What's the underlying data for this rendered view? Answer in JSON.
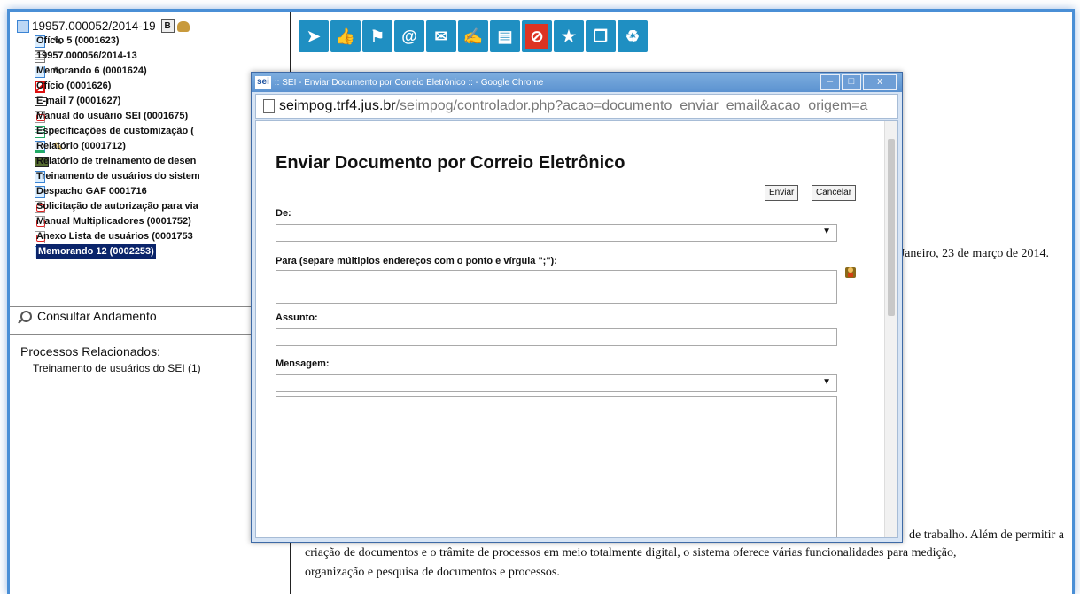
{
  "tree": {
    "process": {
      "label": "19957.000052/2014-19",
      "badge": "B"
    },
    "items": [
      {
        "label": "Ofício 5 (0001623)",
        "icon": "doc-icon",
        "pen": true
      },
      {
        "label": "19957.000056/2014-13",
        "icon": "linked-process-icon"
      },
      {
        "label": "Memorando 6 (0001624)",
        "icon": "doc-icon",
        "pen": true
      },
      {
        "label": "Ofício (0001626)",
        "icon": "cancelled-doc-icon",
        "style": "gray"
      },
      {
        "label": "E-mail 7 (0001627)",
        "icon": "email-icon"
      },
      {
        "label": "Manual do usuário SEI (0001675)",
        "icon": "pdf-icon"
      },
      {
        "label": "Especificações de customização (",
        "icon": "spreadsheet-icon"
      },
      {
        "label": "Relatório (0001712)",
        "icon": "report-icon",
        "pen": "gold"
      },
      {
        "label": "Relatório de treinamento de desen",
        "icon": "video-icon"
      },
      {
        "label": "Treinamento de usuários do sistem",
        "icon": "doc-icon",
        "style": "gray"
      },
      {
        "label": "Despacho GAF 0001716",
        "icon": "doc-icon",
        "style": "gray"
      },
      {
        "label": "Solicitação de autorização para via",
        "icon": "pdf-icon"
      },
      {
        "label": "Manual Multiplicadores (0001752)",
        "icon": "pdf-icon"
      },
      {
        "label": "Anexo Lista de usuários (0001753",
        "icon": "pdf-icon"
      },
      {
        "label": "Memorando 12 (0002253)",
        "icon": "doc-icon",
        "style": "selected",
        "pen": "gold"
      }
    ]
  },
  "consultar_andamento": "Consultar Andamento",
  "processos_relacionados": {
    "title": "Processos Relacionados:",
    "item": "Treinamento de usuários do SEI (1)"
  },
  "toolbar_icons": [
    "send-process-icon",
    "approve-icon",
    "assign-icon",
    "send-email-icon",
    "send-document-icon",
    "sign-icon",
    "print-icon",
    "cancel-icon",
    "favorite-icon",
    "copy-icon",
    "delete-icon"
  ],
  "document": {
    "date_line": "e Janeiro, 23 de março de 2014.",
    "line1": "de trabalho. Além de permitir a",
    "line2": "criação de documentos e o trâmite de processos em meio totalmente digital, o sistema oferece várias funcionalidades para medição,",
    "line3": "organização e pesquisa de documentos e processos."
  },
  "popup": {
    "window_title": ":: SEI - Enviar Documento por Correio Eletrônico :: - Google Chrome",
    "logo": "sei",
    "address_host": "seimpog.trf4.jus.br",
    "address_path": "/seimpog/controlador.php?acao=documento_enviar_email&acao_origem=a",
    "heading": "Enviar Documento por Correio Eletrônico",
    "enviar_label": "Enviar",
    "cancelar_label": "Cancelar",
    "de_label": "De:",
    "para_label": "Para (separe múltiplos endereços com o ponto e vírgula \";\"):",
    "assunto_label": "Assunto:",
    "mensagem_label": "Mensagem:",
    "de_value": "",
    "para_value": "",
    "assunto_value": "",
    "mensagem_select_value": "",
    "mensagem_text": ""
  },
  "colors": {
    "frame": "#4a8fd6",
    "selection": "#0a246a",
    "gray_text": "#e0a78a",
    "toolbar": "#1f8fc2"
  }
}
